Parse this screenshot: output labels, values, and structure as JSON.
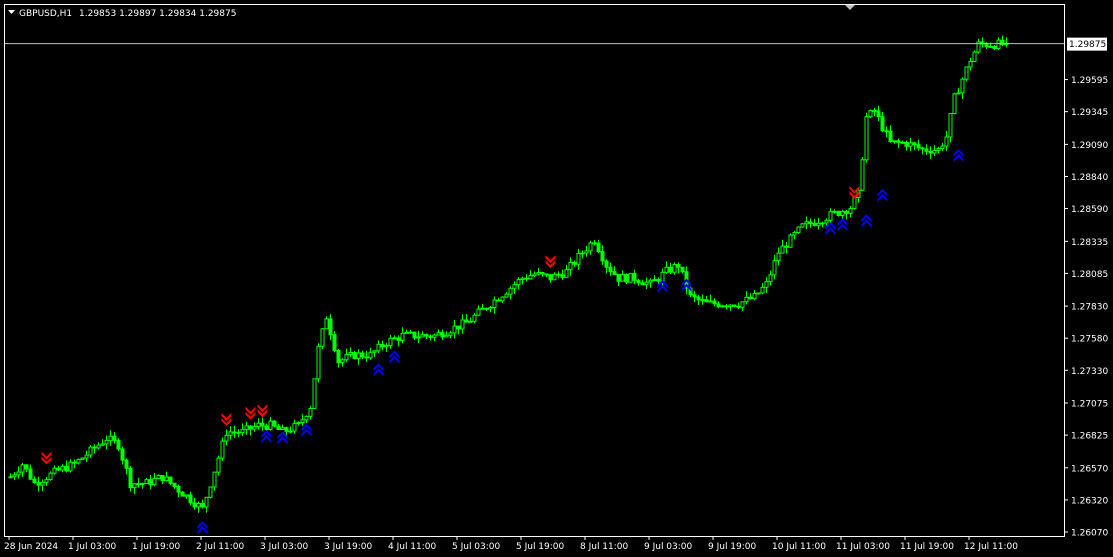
{
  "header": {
    "symbol_label": "GBPUSD,H1",
    "ohlc_label": "1.29853 1.29897 1.29834 1.29875"
  },
  "colors": {
    "background": "#000000",
    "frame": "#ffffff",
    "candle": "#00ff00",
    "price_line": "#c0c0c0",
    "text": "#ffffff",
    "sell_arrow": "#ff0000",
    "buy_arrow": "#0000ff",
    "price_box_bg": "#ffffff",
    "price_box_text": "#000000"
  },
  "icons": {
    "symbol_menu": "triangle-down-icon",
    "shift_marker": "triangle-down-icon",
    "sell_signal": "double-arrow-down-icon",
    "buy_signal": "double-arrow-up-icon"
  },
  "chart_data": {
    "type": "candlestick",
    "timeframe": "H1",
    "current_price": 1.29875,
    "current_price_label": "1.29875",
    "ylim": [
      1.2607,
      1.2995
    ],
    "y_ticks": [
      {
        "value": 1.29595,
        "label": "1.29595"
      },
      {
        "value": 1.29345,
        "label": "1.29345"
      },
      {
        "value": 1.2909,
        "label": "1.29090"
      },
      {
        "value": 1.2884,
        "label": "1.28840"
      },
      {
        "value": 1.2859,
        "label": "1.28590"
      },
      {
        "value": 1.28335,
        "label": "1.28335"
      },
      {
        "value": 1.28085,
        "label": "1.28085"
      },
      {
        "value": 1.2783,
        "label": "1.27830"
      },
      {
        "value": 1.2758,
        "label": "1.27580"
      },
      {
        "value": 1.2733,
        "label": "1.27330"
      },
      {
        "value": 1.27075,
        "label": "1.27075"
      },
      {
        "value": 1.26825,
        "label": "1.26825"
      },
      {
        "value": 1.2657,
        "label": "1.26570"
      },
      {
        "value": 1.2632,
        "label": "1.26320"
      },
      {
        "value": 1.2607,
        "label": "1.26070"
      }
    ],
    "x_ticks": [
      {
        "bar": 0,
        "label": "28 Jun 2024"
      },
      {
        "bar": 16,
        "label": "1 Jul 03:00"
      },
      {
        "bar": 32,
        "label": "1 Jul 19:00"
      },
      {
        "bar": 48,
        "label": "2 Jul 11:00"
      },
      {
        "bar": 64,
        "label": "3 Jul 03:00"
      },
      {
        "bar": 80,
        "label": "3 Jul 19:00"
      },
      {
        "bar": 96,
        "label": "4 Jul 11:00"
      },
      {
        "bar": 112,
        "label": "5 Jul 03:00"
      },
      {
        "bar": 128,
        "label": "5 Jul 19:00"
      },
      {
        "bar": 144,
        "label": "8 Jul 11:00"
      },
      {
        "bar": 160,
        "label": "9 Jul 03:00"
      },
      {
        "bar": 176,
        "label": "9 Jul 19:00"
      },
      {
        "bar": 192,
        "label": "10 Jul 11:00"
      },
      {
        "bar": 208,
        "label": "11 Jul 03:00"
      },
      {
        "bar": 224,
        "label": "11 Jul 19:00"
      },
      {
        "bar": 240,
        "label": "12 Jul 11:00"
      }
    ],
    "close_path": [
      [
        0,
        1.265
      ],
      [
        3,
        1.266
      ],
      [
        6,
        1.2645
      ],
      [
        9,
        1.265
      ],
      [
        12,
        1.2655
      ],
      [
        16,
        1.266
      ],
      [
        20,
        1.267
      ],
      [
        24,
        1.268
      ],
      [
        27,
        1.2675
      ],
      [
        30,
        1.2645
      ],
      [
        34,
        1.2645
      ],
      [
        38,
        1.265
      ],
      [
        42,
        1.264
      ],
      [
        46,
        1.263
      ],
      [
        48,
        1.2625
      ],
      [
        51,
        1.2655
      ],
      [
        54,
        1.2685
      ],
      [
        58,
        1.2685
      ],
      [
        62,
        1.269
      ],
      [
        65,
        1.269
      ],
      [
        68,
        1.2685
      ],
      [
        72,
        1.269
      ],
      [
        75,
        1.2705
      ],
      [
        77,
        1.275
      ],
      [
        79,
        1.2775
      ],
      [
        82,
        1.274
      ],
      [
        86,
        1.2745
      ],
      [
        90,
        1.2745
      ],
      [
        94,
        1.2755
      ],
      [
        98,
        1.276
      ],
      [
        102,
        1.276
      ],
      [
        106,
        1.276
      ],
      [
        110,
        1.2765
      ],
      [
        114,
        1.277
      ],
      [
        118,
        1.278
      ],
      [
        122,
        1.279
      ],
      [
        126,
        1.28
      ],
      [
        128,
        1.2805
      ],
      [
        131,
        1.2808
      ],
      [
        135,
        1.2805
      ],
      [
        139,
        1.281
      ],
      [
        143,
        1.2825
      ],
      [
        146,
        1.2835
      ],
      [
        149,
        1.2815
      ],
      [
        152,
        1.2805
      ],
      [
        156,
        1.2805
      ],
      [
        160,
        1.28
      ],
      [
        164,
        1.281
      ],
      [
        167,
        1.2815
      ],
      [
        170,
        1.279
      ],
      [
        174,
        1.2785
      ],
      [
        178,
        1.2785
      ],
      [
        182,
        1.2785
      ],
      [
        186,
        1.279
      ],
      [
        189,
        1.28
      ],
      [
        192,
        1.2825
      ],
      [
        195,
        1.2835
      ],
      [
        198,
        1.2845
      ],
      [
        202,
        1.285
      ],
      [
        206,
        1.2855
      ],
      [
        210,
        1.286
      ],
      [
        212,
        1.287
      ],
      [
        214,
        1.293
      ],
      [
        216,
        1.2935
      ],
      [
        220,
        1.291
      ],
      [
        224,
        1.291
      ],
      [
        228,
        1.2905
      ],
      [
        232,
        1.2905
      ],
      [
        234,
        1.2915
      ],
      [
        236,
        1.2945
      ],
      [
        238,
        1.296
      ],
      [
        240,
        1.2975
      ],
      [
        242,
        1.2987
      ],
      [
        246,
        1.2987
      ],
      [
        249,
        1.2987
      ]
    ],
    "sell_signals": [
      {
        "bar": 9,
        "price": 1.2665
      },
      {
        "bar": 54,
        "price": 1.2695
      },
      {
        "bar": 60,
        "price": 1.27
      },
      {
        "bar": 63,
        "price": 1.2702
      },
      {
        "bar": 135,
        "price": 1.2818
      },
      {
        "bar": 211,
        "price": 1.2872
      }
    ],
    "buy_signals": [
      {
        "bar": 48,
        "price": 1.261
      },
      {
        "bar": 64,
        "price": 1.2681
      },
      {
        "bar": 68,
        "price": 1.268
      },
      {
        "bar": 74,
        "price": 1.2686
      },
      {
        "bar": 92,
        "price": 1.2733
      },
      {
        "bar": 96,
        "price": 1.2743
      },
      {
        "bar": 163,
        "price": 1.2798
      },
      {
        "bar": 169,
        "price": 1.2799
      },
      {
        "bar": 205,
        "price": 1.2843
      },
      {
        "bar": 208,
        "price": 1.2846
      },
      {
        "bar": 214,
        "price": 1.2849
      },
      {
        "bar": 218,
        "price": 1.2869
      },
      {
        "bar": 237,
        "price": 1.29
      }
    ]
  }
}
